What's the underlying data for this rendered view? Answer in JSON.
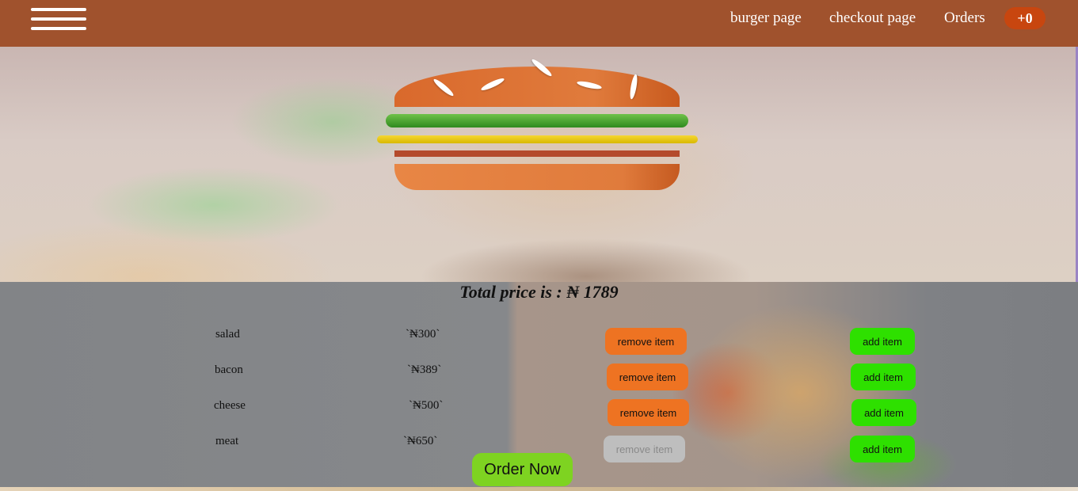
{
  "nav": {
    "links": [
      "burger page",
      "checkout page",
      "Orders"
    ],
    "cart_count": "+0"
  },
  "summary": {
    "total_price": "Total price is : ₦ 1789"
  },
  "ingredients": [
    {
      "label": "salad",
      "price": "`₦300`",
      "remove_label": "remove item",
      "add_label": "add item",
      "remove_disabled": false
    },
    {
      "label": "bacon",
      "price": "`₦389`",
      "remove_label": "remove item",
      "add_label": "add item",
      "remove_disabled": false
    },
    {
      "label": "cheese",
      "price": "`₦500`",
      "remove_label": "remove item",
      "add_label": "add item",
      "remove_disabled": false
    },
    {
      "label": "meat",
      "price": "`₦650`",
      "remove_label": "remove item",
      "add_label": "add item",
      "remove_disabled": true
    }
  ],
  "order_button_label": "Order Now",
  "colors": {
    "navbar": "#a0522d",
    "cart_badge": "#c8460f",
    "remove_button": "#ee7322",
    "remove_button_disabled": "#bebebe",
    "add_button": "#2ee000",
    "order_button": "#7ed321"
  }
}
